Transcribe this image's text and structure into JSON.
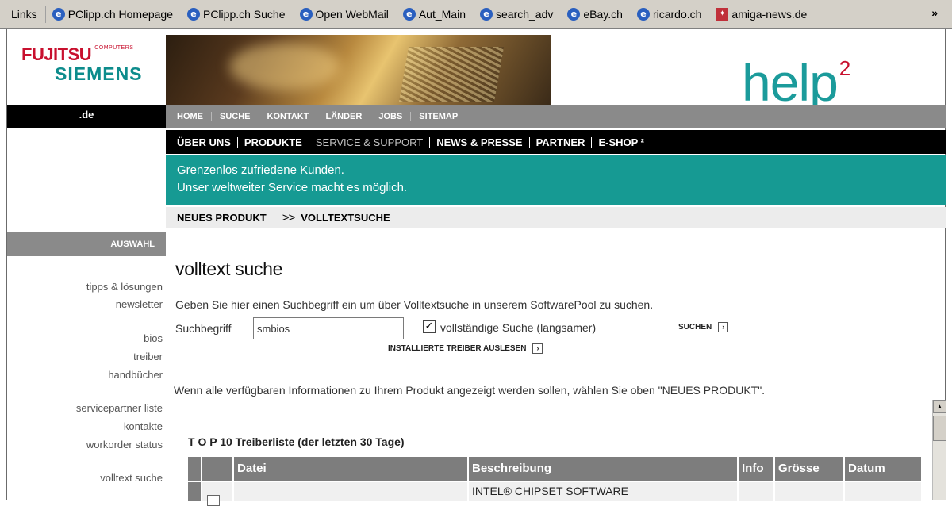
{
  "links_toolbar": {
    "label": "Links",
    "items": [
      {
        "label": "PClipp.ch Homepage",
        "icon": "ie-page-icon"
      },
      {
        "label": "PClipp.ch Suche",
        "icon": "ie-page-icon"
      },
      {
        "label": "Open WebMail",
        "icon": "ie-page-icon"
      },
      {
        "label": "Aut_Main",
        "icon": "ie-page-icon"
      },
      {
        "label": "search_adv",
        "icon": "ie-page-icon"
      },
      {
        "label": "eBay.ch",
        "icon": "ie-page-icon"
      },
      {
        "label": "ricardo.ch",
        "icon": "ie-page-icon"
      },
      {
        "label": "amiga-news.de",
        "icon": "amiga-icon"
      }
    ],
    "more": "»"
  },
  "brand": {
    "fujitsu": "FUJITSU",
    "computers": "COMPUTERS",
    "siemens": "SIEMENS",
    "help": "help",
    "help_sup": "2",
    "region": ".de"
  },
  "nav_gray": [
    "HOME",
    "SUCHE",
    "KONTAKT",
    "LÄNDER",
    "JOBS",
    "SITEMAP"
  ],
  "nav_black": [
    "ÜBER UNS",
    "PRODUKTE",
    "SERVICE & SUPPORT",
    "NEWS & PRESSE",
    "PARTNER",
    "E-SHOP ²"
  ],
  "teal_banner": {
    "line1": "Grenzenlos zufriedene Kunden.",
    "line2": "Unser weltweiter Service macht es möglich."
  },
  "breadcrumb": {
    "first": "NEUES PRODUKT",
    "sep": ">>",
    "current": "VOLLTEXTSUCHE"
  },
  "sidebar": {
    "header": "AUSWAHL",
    "items": [
      "tipps & lösungen",
      "newsletter",
      "bios",
      "treiber",
      "handbücher",
      "servicepartner liste",
      "kontakte",
      "workorder status",
      "volltext suche"
    ]
  },
  "content": {
    "title": "volltext suche",
    "intro": "Geben Sie hier einen Suchbegriff ein um über Volltextsuche in unserem SoftwarePool zu suchen.",
    "search_label": "Suchbegriff",
    "search_value": "smbios",
    "checkbox_label": "vollständige Suche (langsamer)",
    "checkbox_checked": true,
    "search_button": "SUCHEN",
    "driver_button": "INSTALLIERTE TREIBER AUSLESEN",
    "note": "Wenn alle verfügbaren Informationen zu Ihrem Produkt angezeigt werden sollen, wählen Sie oben \"NEUES PRODUKT\".",
    "top10_title": "T O P 10 Treiberliste (der letzten 30 Tage)"
  },
  "table": {
    "headers": [
      "Datei",
      "Beschreibung",
      "Info",
      "Grösse",
      "Datum"
    ],
    "rows": [
      [
        "",
        "INTEL® CHIPSET SOFTWARE",
        "",
        "",
        ""
      ]
    ]
  }
}
